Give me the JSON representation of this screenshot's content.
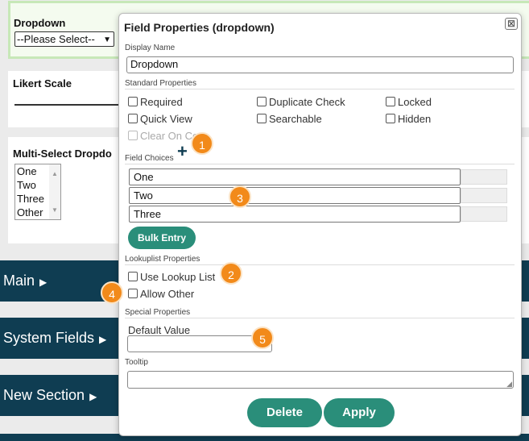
{
  "background": {
    "dropdown_label": "Dropdown",
    "dropdown_value": "--Please Select--",
    "likert_label": "Likert Scale",
    "multiselect_label": "Multi-Select Dropdo",
    "multiselect_options": [
      "One",
      "Two",
      "Three",
      "Other"
    ],
    "sections": [
      "Main",
      "System Fields",
      "New Section"
    ]
  },
  "modal": {
    "title": "Field Properties (dropdown)",
    "close_symbol": "⊠",
    "display_name_label": "Display Name",
    "display_name_value": "Dropdown",
    "standard_properties_label": "Standard Properties",
    "checkboxes": {
      "required": "Required",
      "duplicate_check": "Duplicate Check",
      "locked": "Locked",
      "quick_view": "Quick View",
      "searchable": "Searchable",
      "hidden": "Hidden",
      "clear_on_copy": "Clear On Co"
    },
    "field_choices_label": "Field Choices",
    "choices": [
      "One",
      "Two",
      "Three"
    ],
    "bulk_entry_label": "Bulk Entry",
    "lookuplist_properties_label": "Lookuplist Properties",
    "use_lookup_list_label": "Use Lookup List",
    "allow_other_label": "Allow Other",
    "special_properties_label": "Special Properties",
    "default_value_label": "Default Value",
    "tooltip_label": "Tooltip",
    "delete_label": "Delete",
    "apply_label": "Apply"
  },
  "badges": [
    "1",
    "2",
    "3",
    "4",
    "5"
  ],
  "colors": {
    "accent_teal": "#2a8e7a",
    "section_navy": "#0f3d52",
    "badge_orange": "#f28a1a"
  }
}
